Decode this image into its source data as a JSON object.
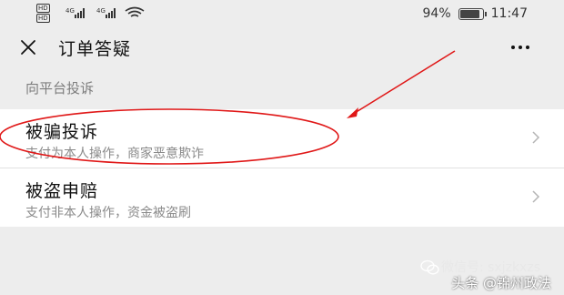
{
  "status": {
    "battery": "94%",
    "time": "11:47",
    "battery_level": 0.94,
    "net1": "4G",
    "net2": "4G"
  },
  "nav": {
    "title": "订单答疑"
  },
  "section": {
    "label": "向平台投诉"
  },
  "options": [
    {
      "title": "被骗投诉",
      "subtitle": "支付为本人操作，商家恶意欺诈"
    },
    {
      "title": "被盗申赔",
      "subtitle": "支付非本人操作，资金被盗刷"
    }
  ],
  "watermark": {
    "line1": "微信号: sxjzkxzs",
    "line2": "头条 @锦州政法"
  },
  "colors": {
    "annotation": "#e01818",
    "background": "#ededed"
  }
}
